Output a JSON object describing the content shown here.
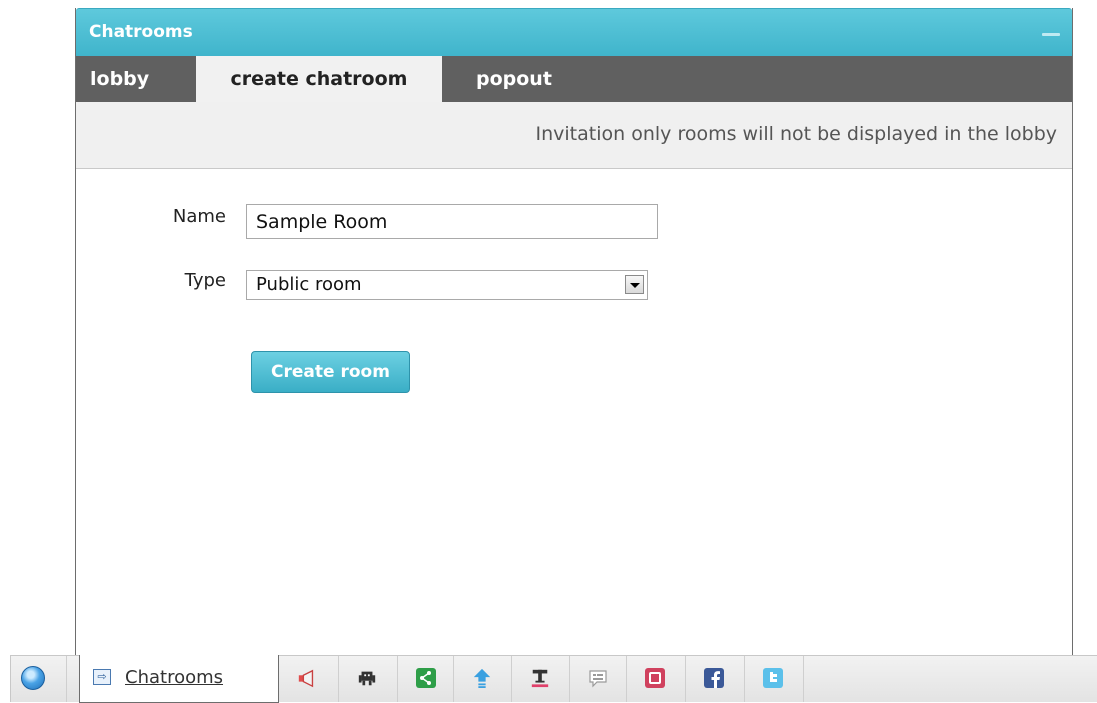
{
  "window": {
    "title": "Chatrooms"
  },
  "tabs": [
    {
      "label": "lobby"
    },
    {
      "label": "create chatroom",
      "active": true
    },
    {
      "label": "popout"
    }
  ],
  "info": {
    "text": "Invitation only rooms will not be displayed in the lobby"
  },
  "form": {
    "name_label": "Name",
    "name_value": "Sample Room",
    "type_label": "Type",
    "type_value": "Public room",
    "create_button": "Create room"
  },
  "taskbar": {
    "chatrooms_label": "Chatrooms",
    "icons": [
      "globe-icon",
      "chatrooms-icon",
      "announcement-icon",
      "games-icon",
      "share-icon",
      "upload-icon",
      "text-format-icon",
      "chat-bubble-icon",
      "pinterest-icon",
      "facebook-icon",
      "twitter-icon"
    ]
  },
  "colors": {
    "accent": "#46b9cf",
    "tab_bar": "#606060",
    "active_tab": "#f1f1f1"
  }
}
